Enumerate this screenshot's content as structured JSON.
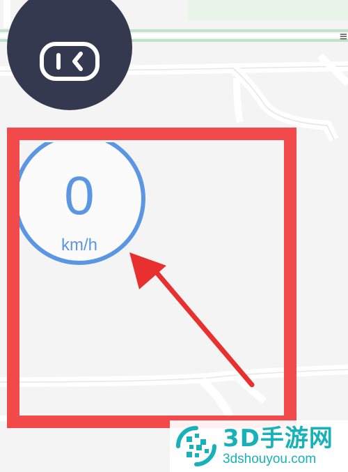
{
  "speedometer": {
    "value": "0",
    "unit": "km/h"
  },
  "nav_button": {
    "icon": "steering-toggle-icon"
  },
  "watermark": {
    "title": "3D手游网",
    "url": "3dshouyou.com"
  },
  "colors": {
    "accent_blue": "#5b96e3",
    "highlight_red": "#f24a4a",
    "button_dark": "#34394f",
    "watermark_teal": "#17b2b9"
  }
}
